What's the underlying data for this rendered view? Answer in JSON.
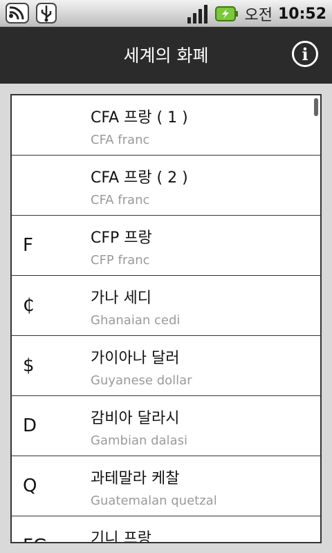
{
  "status_bar": {
    "ampm": "오전",
    "time": "10:52",
    "icons": [
      "wifi-notification-icon",
      "usb-icon",
      "signal-icon",
      "battery-charging-icon"
    ]
  },
  "header": {
    "title": "세계의 화폐",
    "info_icon": "i"
  },
  "currencies": [
    {
      "symbol": "",
      "name": "CFA 프랑 ( 1 )",
      "english": "CFA franc"
    },
    {
      "symbol": "",
      "name": "CFA 프랑 ( 2 )",
      "english": "CFA franc"
    },
    {
      "symbol": "F",
      "name": "CFP 프랑",
      "english": "CFP franc"
    },
    {
      "symbol": "₵",
      "name": "가나 세디",
      "english": "Ghanaian cedi"
    },
    {
      "symbol": "$",
      "name": "가이아나 달러",
      "english": "Guyanese dollar"
    },
    {
      "symbol": "D",
      "name": "감비아 달라시",
      "english": "Gambian dalasi"
    },
    {
      "symbol": "Q",
      "name": "과테말라 케찰",
      "english": "Guatemalan quetzal"
    },
    {
      "symbol": "FG",
      "name": "기니 프랑",
      "english": ""
    }
  ]
}
